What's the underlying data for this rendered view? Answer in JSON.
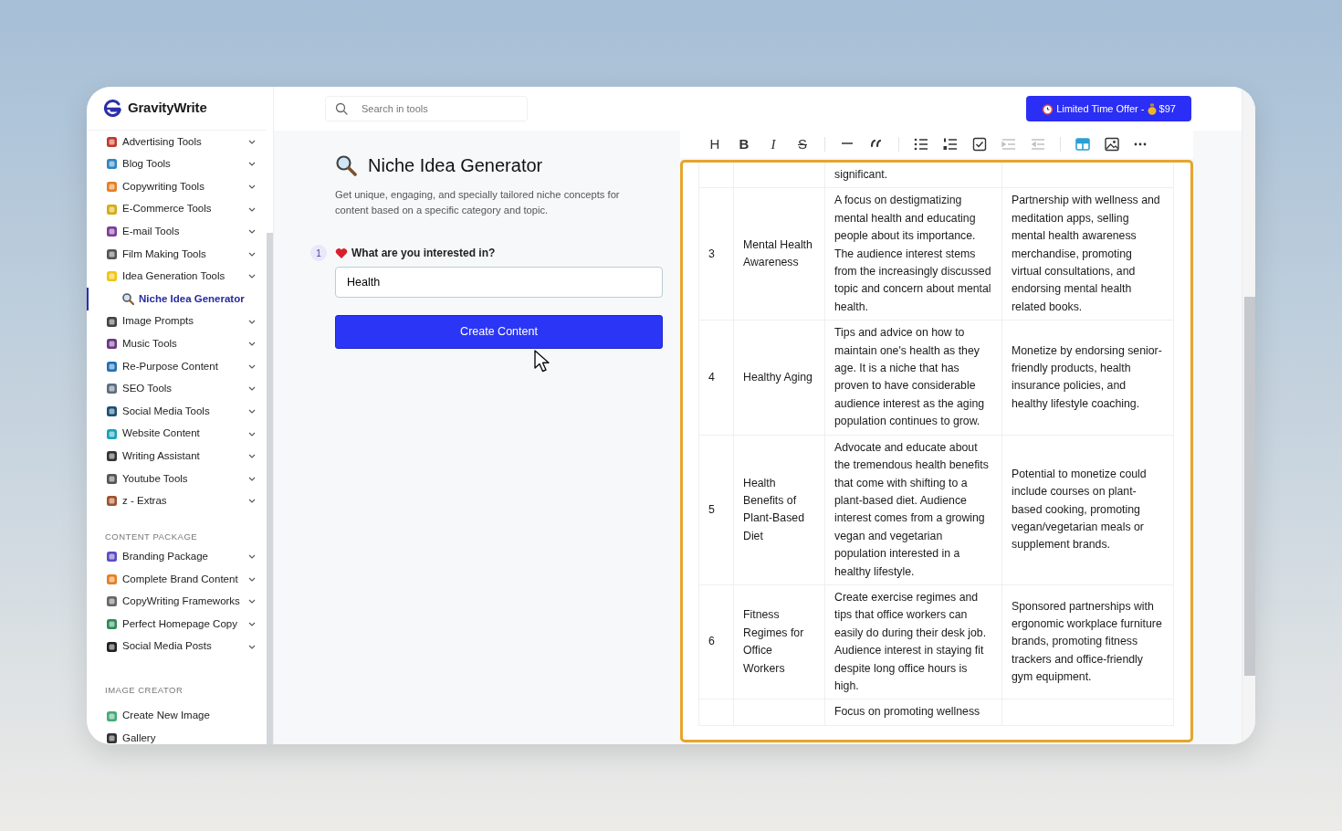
{
  "brand": {
    "name": "GravityWrite"
  },
  "sidebar": {
    "sections": [
      {
        "items": [
          {
            "label": "Advertising Tools",
            "kind": "group",
            "selected": false
          },
          {
            "label": "Blog Tools",
            "kind": "group",
            "selected": false
          },
          {
            "label": "Copywriting Tools",
            "kind": "group",
            "selected": false
          },
          {
            "label": "E-Commerce Tools",
            "kind": "group",
            "selected": false
          },
          {
            "label": "E-mail Tools",
            "kind": "group",
            "selected": false
          },
          {
            "label": "Film Making Tools",
            "kind": "group",
            "selected": false
          },
          {
            "label": "Idea Generation Tools",
            "kind": "group",
            "selected": false,
            "children": [
              {
                "label": "Niche Idea Generator",
                "kind": "link",
                "selected": true
              }
            ]
          },
          {
            "label": "Image Prompts",
            "kind": "group",
            "selected": false
          },
          {
            "label": "Music Tools",
            "kind": "group",
            "selected": false
          },
          {
            "label": "Re-Purpose Content",
            "kind": "group",
            "selected": false
          },
          {
            "label": "SEO Tools",
            "kind": "group",
            "selected": false
          },
          {
            "label": "Social Media Tools",
            "kind": "group",
            "selected": false
          },
          {
            "label": "Website Content",
            "kind": "group",
            "selected": false
          },
          {
            "label": "Writing Assistant",
            "kind": "group",
            "selected": false
          },
          {
            "label": "Youtube Tools",
            "kind": "group",
            "selected": false
          },
          {
            "label": "z - Extras",
            "kind": "group",
            "selected": false
          }
        ]
      },
      {
        "heading": "CONTENT PACKAGE",
        "items": [
          {
            "label": "Branding Package",
            "kind": "group",
            "selected": false
          },
          {
            "label": "Complete Brand Content",
            "kind": "group",
            "selected": false
          },
          {
            "label": "CopyWriting Frameworks",
            "kind": "group",
            "selected": false
          },
          {
            "label": "Perfect Homepage Copy",
            "kind": "group",
            "selected": false
          },
          {
            "label": "Social Media Posts",
            "kind": "group",
            "selected": false
          }
        ]
      },
      {
        "heading": "IMAGE CREATOR",
        "items": [
          {
            "label": "Create New Image",
            "kind": "link",
            "selected": false
          },
          {
            "label": "Gallery",
            "kind": "link",
            "selected": false
          }
        ]
      }
    ]
  },
  "search": {
    "placeholder": "Search in tools"
  },
  "offer_button": {
    "label": "Limited Time Offer - ",
    "price": "$97"
  },
  "tool": {
    "title": "Niche Idea Generator",
    "description": "Get unique, engaging, and specially tailored niche concepts for content based on a specific category and topic.",
    "fields": [
      {
        "step": "1",
        "label": "What are you interested in?",
        "value": "Health"
      }
    ],
    "submit": "Create Content"
  },
  "toolbar": [
    [
      {
        "kind": "heading",
        "label": "H",
        "disabled": false,
        "active": false
      },
      {
        "kind": "bold",
        "label": "B",
        "disabled": false,
        "active": false
      },
      {
        "kind": "italic",
        "label": "I",
        "disabled": false,
        "active": false
      },
      {
        "kind": "strike",
        "label": "S",
        "disabled": false,
        "active": false
      }
    ],
    [
      {
        "kind": "rule",
        "disabled": false,
        "active": false
      },
      {
        "kind": "quote",
        "disabled": false,
        "active": false
      }
    ],
    [
      {
        "kind": "bullets",
        "disabled": false,
        "active": false
      },
      {
        "kind": "numbered",
        "disabled": false,
        "active": false
      },
      {
        "kind": "task",
        "disabled": false,
        "active": false
      },
      {
        "kind": "indent",
        "disabled": true,
        "active": false
      },
      {
        "kind": "outdent",
        "disabled": true,
        "active": false
      }
    ],
    [
      {
        "kind": "table",
        "disabled": false,
        "active": true
      },
      {
        "kind": "image",
        "disabled": false,
        "active": false
      },
      {
        "kind": "more",
        "disabled": false,
        "active": false
      }
    ]
  ],
  "table": {
    "rows": [
      {
        "column_3": "significant."
      },
      {
        "column_1": "3",
        "column_2": "Mental Health Awareness",
        "column_3": "A focus on destigmatizing mental health and educating people about its importance. The audience interest stems from the increasingly discussed topic and concern about mental health.",
        "column_4": "Partnership with wellness and meditation apps, selling mental health awareness merchandise, promoting virtual consultations, and endorsing mental health related books."
      },
      {
        "column_1": "4",
        "column_2": "Healthy Aging",
        "column_3": "Tips and advice on how to maintain one's health as they age. It is a niche that has proven to have considerable audience interest as the aging population continues to grow.",
        "column_4": "Monetize by endorsing senior-friendly products, health insurance policies, and healthy lifestyle coaching."
      },
      {
        "column_1": "5",
        "column_2": "Health Benefits of Plant-Based Diet",
        "column_3": "Advocate and educate about the tremendous health benefits that come with shifting to a plant-based diet. Audience interest comes from a growing vegan and vegetarian population interested in a healthy lifestyle.",
        "column_4": "Potential to monetize could include courses on plant-based cooking, promoting vegan/vegetarian meals or supplement brands."
      },
      {
        "column_1": "6",
        "column_2": "Fitness Regimes for Office Workers",
        "column_3": "Create exercise regimes and tips that office workers can easily do during their desk job. Audience interest in staying fit despite long office hours is high.",
        "column_4": "Sponsored partnerships with ergonomic workplace furniture brands, promoting fitness trackers and office-friendly gym equipment."
      },
      {
        "column_3": "Focus on promoting wellness"
      }
    ]
  }
}
